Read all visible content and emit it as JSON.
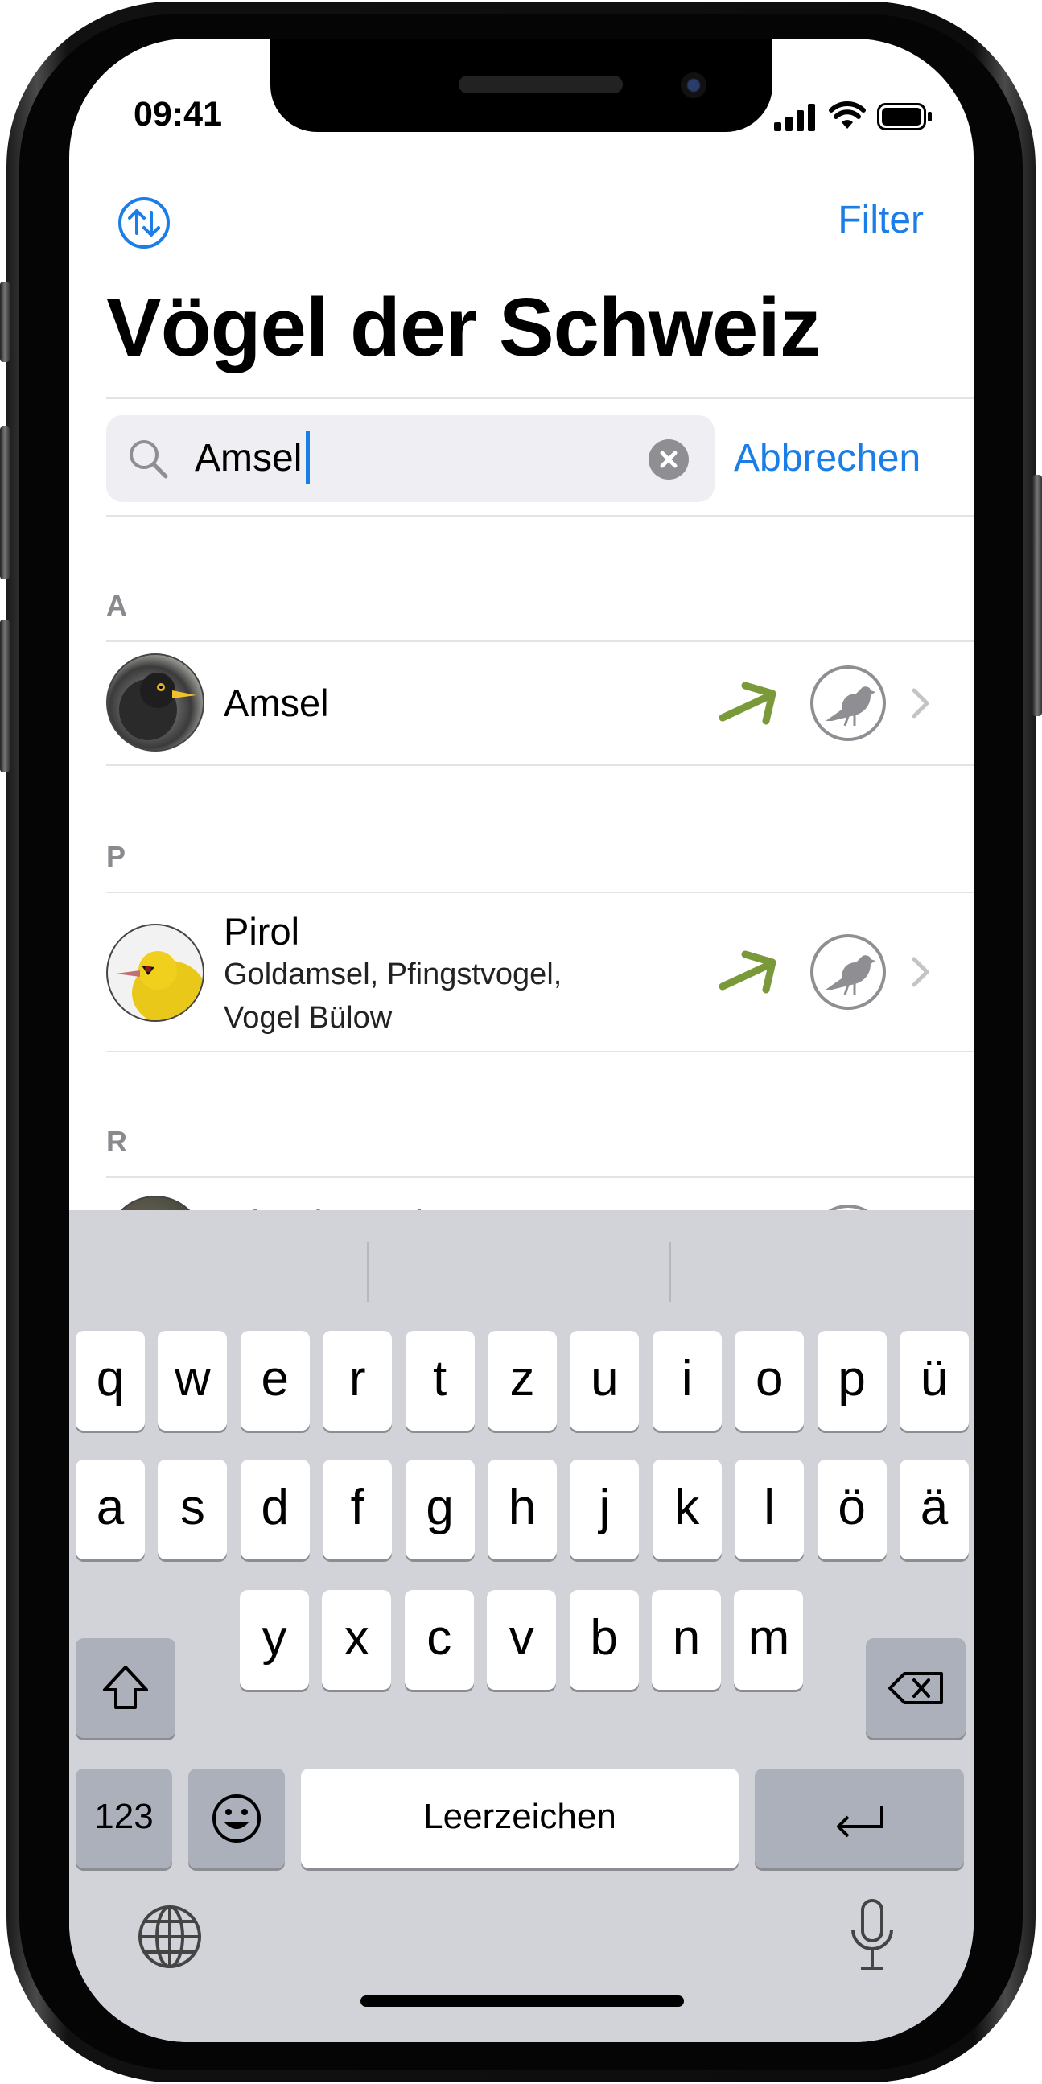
{
  "status_bar": {
    "time": "09:41"
  },
  "nav": {
    "filter_label": "Filter"
  },
  "page_title": "Vögel der Schweiz",
  "search": {
    "value": "Amsel",
    "cancel_label": "Abbrechen"
  },
  "sections": [
    {
      "letter": "A",
      "items": [
        {
          "name": "Amsel",
          "aliases": []
        }
      ]
    },
    {
      "letter": "P",
      "items": [
        {
          "name": "Pirol",
          "aliases": [
            "Goldamsel, Pfingstvogel,",
            "Vogel Bülow"
          ]
        }
      ]
    },
    {
      "letter": "R",
      "items": [
        {
          "name": "Ringdrossel",
          "aliases": []
        }
      ]
    }
  ],
  "keyboard": {
    "row1": [
      "q",
      "w",
      "e",
      "r",
      "t",
      "z",
      "u",
      "i",
      "o",
      "p",
      "ü"
    ],
    "row2": [
      "a",
      "s",
      "d",
      "f",
      "g",
      "h",
      "j",
      "k",
      "l",
      "ö",
      "ä"
    ],
    "row3": [
      "y",
      "x",
      "c",
      "v",
      "b",
      "n",
      "m"
    ],
    "numbers_label": "123",
    "space_label": "Leerzeichen"
  },
  "colors": {
    "accent": "#1a7ee6",
    "trend_arrow": "#7a9a3a"
  }
}
